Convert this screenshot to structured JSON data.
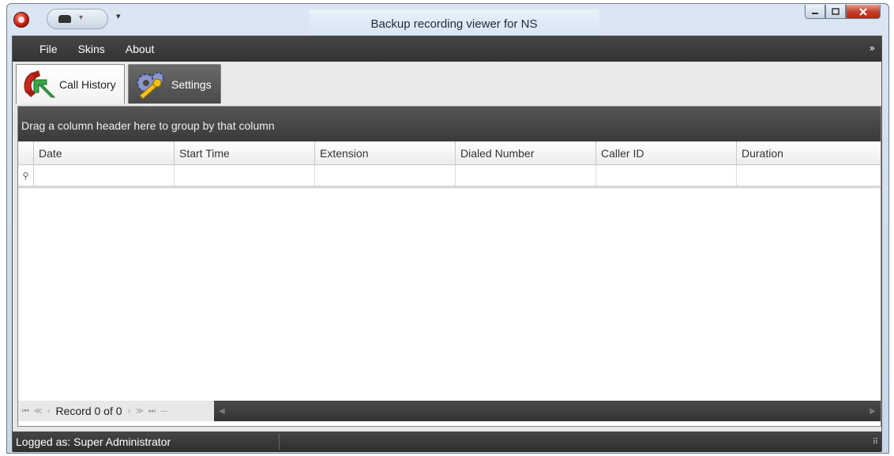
{
  "window": {
    "title": "Backup recording viewer for NS",
    "controls": {
      "minimize_icon": "minimize-icon",
      "maximize_icon": "maximize-icon",
      "close_icon": "close-icon"
    }
  },
  "quick_access": {
    "customize_glyph": "▾",
    "dropdown_glyph": "▾"
  },
  "menu": {
    "items": [
      "File",
      "Skins",
      "About"
    ],
    "collapse_glyph": "»"
  },
  "tabs": [
    {
      "label": "Call History",
      "icon": "phone-arrow-icon",
      "active": true
    },
    {
      "label": "Settings",
      "icon": "gears-wrench-icon",
      "active": false
    }
  ],
  "grid": {
    "group_panel_text": "Drag a column header here to group by that column",
    "columns": [
      "Date",
      "Start Time",
      "Extension",
      "Dialed Number",
      "Caller ID",
      "Duration"
    ],
    "filter_glyph": "⚲",
    "navigator": {
      "record_text": "Record 0 of 0",
      "first": "⏮",
      "prev_page": "≪",
      "prev": "‹",
      "next": "›",
      "next_page": "≫",
      "last": "⏭",
      "delete": "—"
    }
  },
  "status": {
    "text": "Logged as: Super Administrator",
    "grip": "⠿"
  },
  "colors": {
    "dark_chrome": "#3a3a3a",
    "frame": "#c9d7e8",
    "close_button": "#c7402a"
  }
}
